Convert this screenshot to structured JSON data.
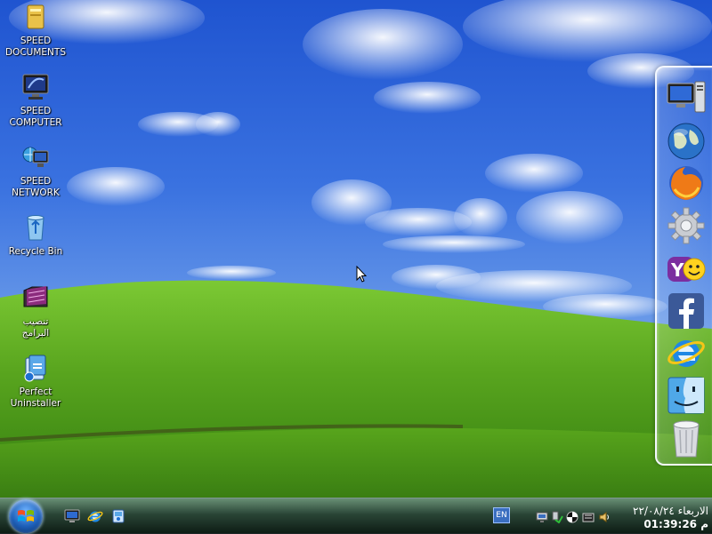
{
  "desktop": {
    "icons": [
      {
        "label": "SPEED\nDOCUMENTS",
        "icon": "folder-icon"
      },
      {
        "label": "SPEED\nCOMPUTER",
        "icon": "monitor-icon"
      },
      {
        "label": "SPEED\nNETWORK",
        "icon": "network-icon"
      },
      {
        "label": "Recycle Bin",
        "icon": "recycle-bin-icon"
      },
      {
        "label": "تنصيب\nالبرامج",
        "icon": "software-folder-icon"
      },
      {
        "label": "Perfect\nUninstaller",
        "icon": "uninstaller-icon"
      }
    ]
  },
  "dock": {
    "items": [
      {
        "name": "computer",
        "icon": "computer-icon"
      },
      {
        "name": "globe",
        "icon": "globe-icon"
      },
      {
        "name": "firefox",
        "icon": "firefox-icon"
      },
      {
        "name": "settings",
        "icon": "gear-icon"
      },
      {
        "name": "yahoo messenger",
        "icon": "yahoo-messenger-icon"
      },
      {
        "name": "facebook",
        "icon": "facebook-icon"
      },
      {
        "name": "internet explorer",
        "icon": "internet-explorer-icon"
      },
      {
        "name": "finder",
        "icon": "finder-icon"
      },
      {
        "name": "trash",
        "icon": "trash-icon"
      }
    ]
  },
  "taskbar": {
    "quick_launch": [
      "show-desktop-icon",
      "internet-explorer-icon",
      "windows-explorer-icon"
    ],
    "language": "EN",
    "tray_icons": [
      "network-tray-icon",
      "safely-remove-icon",
      "antivirus-icon",
      "display-icon",
      "volume-icon"
    ],
    "clock": {
      "date": "الاربعاء ٢٢/٠٨/٢٤",
      "time": "01:39:26 م"
    }
  },
  "colors": {
    "sky_top": "#2a5fd6",
    "sky_horizon": "#8fb8f0",
    "grass_light": "#6fbf2c",
    "grass_dark": "#2f6e12",
    "dock_border": "#f4f8ff"
  }
}
